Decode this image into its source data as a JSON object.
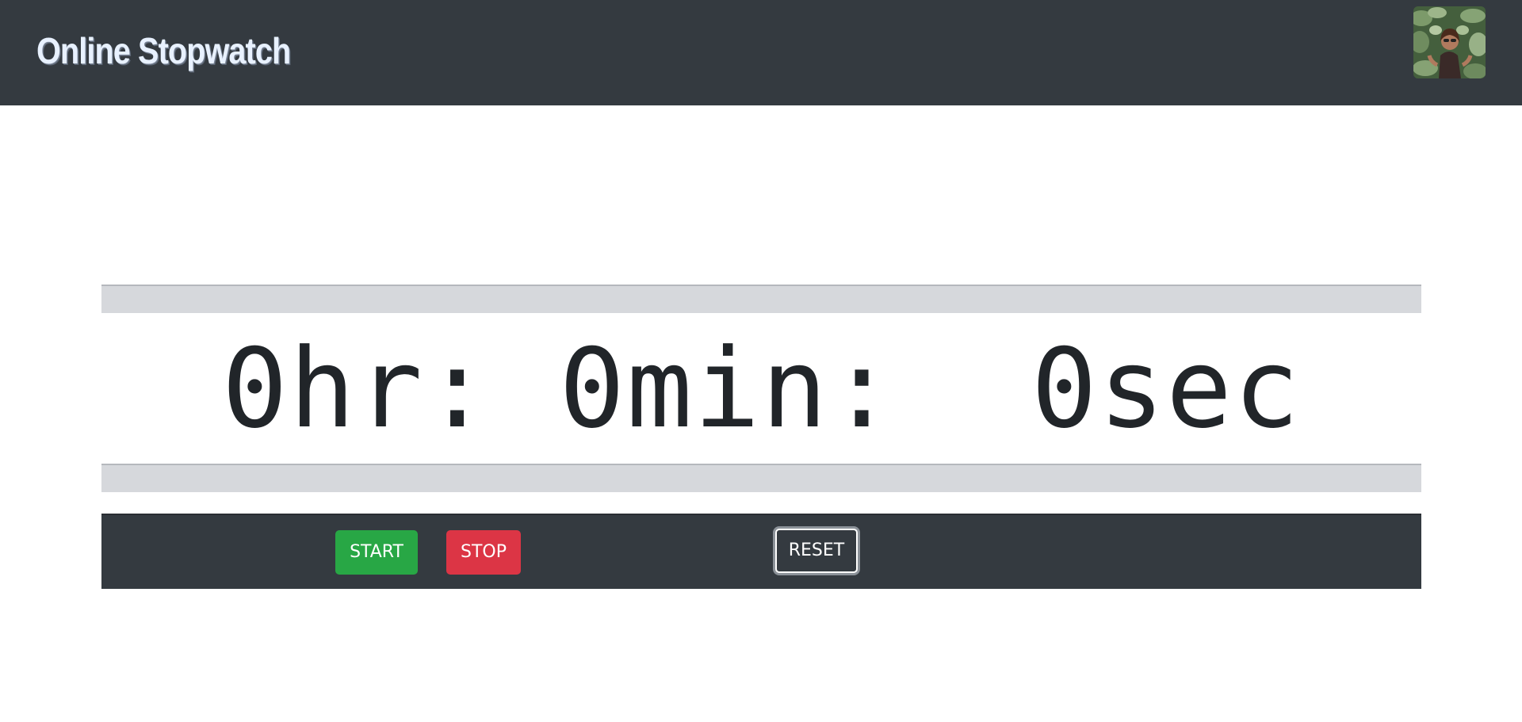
{
  "header": {
    "title": "Online Stopwatch"
  },
  "stopwatch": {
    "display": "0hr: 0min:  0sec"
  },
  "controls": {
    "start_label": "START",
    "stop_label": "STOP",
    "reset_label": "RESET"
  },
  "colors": {
    "header_bg": "#343a40",
    "start": "#28a745",
    "stop": "#dc3545",
    "band": "#d6d8dc"
  },
  "icons": {
    "avatar": "user-avatar-photo"
  }
}
